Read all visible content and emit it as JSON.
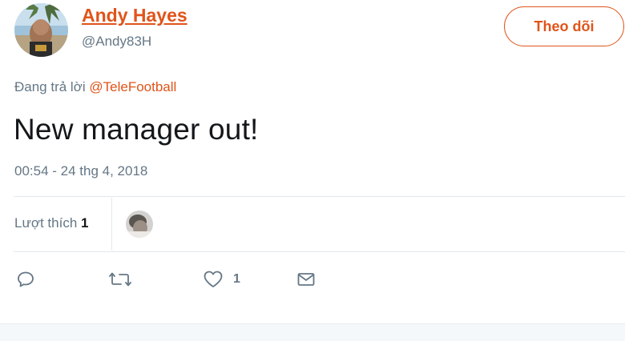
{
  "user": {
    "name": "Andy Hayes",
    "handle": "@Andy83H"
  },
  "follow_button": {
    "label": "Theo dõi"
  },
  "reply": {
    "prefix": "Đang trả lời",
    "mention": "@TeleFootball"
  },
  "tweet": {
    "text": "New manager out!",
    "timestamp": "00:54 - 24 thg 4, 2018"
  },
  "likes": {
    "label": "Lượt thích",
    "count": "1"
  },
  "actions": {
    "reply_icon": "reply-icon",
    "retweet_icon": "retweet-icon",
    "like_icon": "heart-icon",
    "like_count": "1",
    "message_icon": "envelope-icon"
  },
  "colors": {
    "accent": "#e0541a",
    "secondary_text": "#657786",
    "primary_text": "#14171a",
    "divider": "#e1e8ed"
  }
}
